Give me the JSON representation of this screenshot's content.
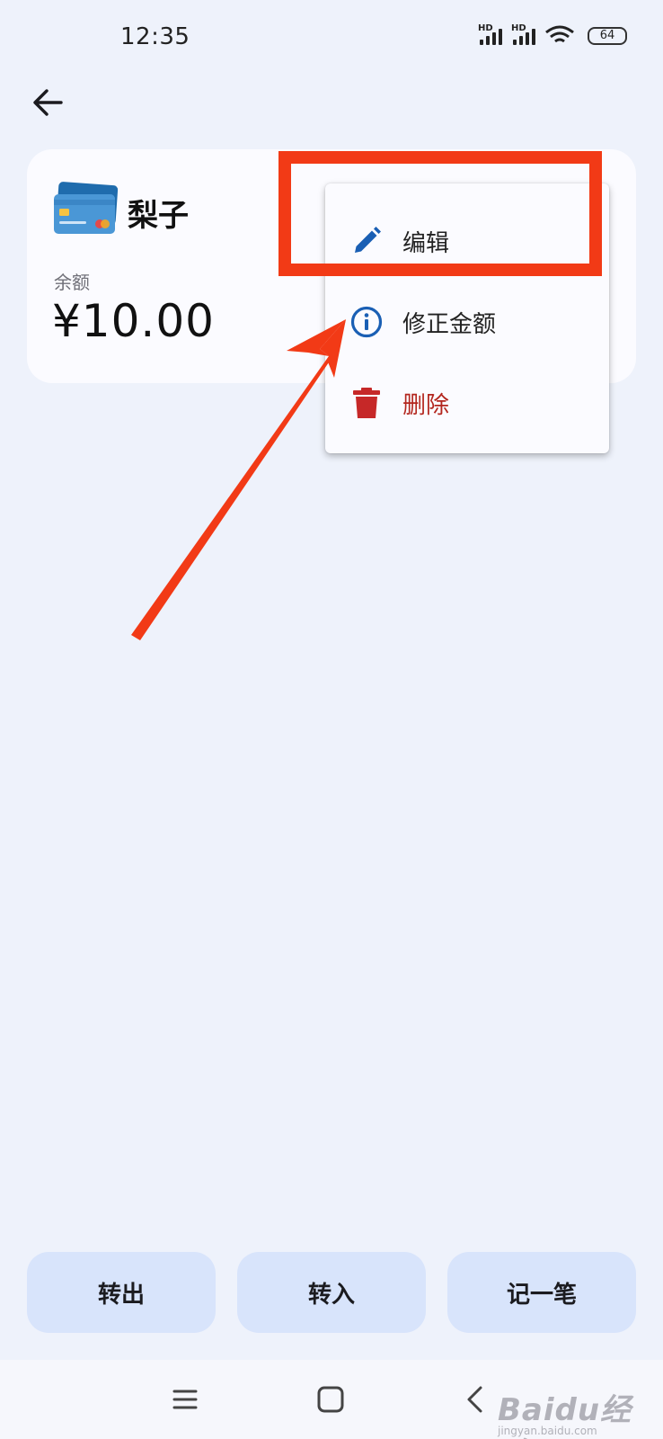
{
  "status_bar": {
    "time": "12:35",
    "signal_1_label": "HD",
    "signal_2_label": "HD",
    "battery": "64"
  },
  "account": {
    "name": "梨子",
    "balance_label": "余额",
    "balance": "¥10.00"
  },
  "menu": {
    "items": [
      {
        "label": "编辑",
        "icon": "pencil-icon"
      },
      {
        "label": "修正金额",
        "icon": "info-icon"
      },
      {
        "label": "删除",
        "icon": "trash-icon"
      }
    ]
  },
  "actions": {
    "transfer_out": "转出",
    "transfer_in": "转入",
    "record": "记一笔"
  },
  "watermark": {
    "text": "Baidu经验",
    "sub": "jingyan.baidu.com"
  },
  "colors": {
    "background": "#eef2fb",
    "card": "#fbfbff",
    "action_button": "#d8e4fb",
    "accent_blue": "#1a5fb4",
    "danger": "#b3261e",
    "annotation_red": "#f23a16"
  }
}
